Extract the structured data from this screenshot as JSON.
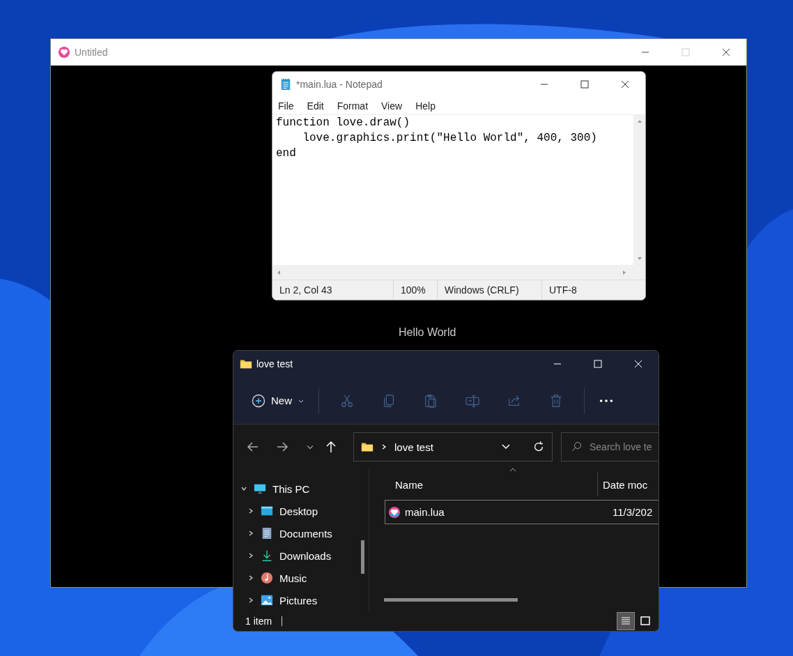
{
  "love_window": {
    "title": "Untitled",
    "canvas_text": "Hello World"
  },
  "notepad": {
    "title": "*main.lua - Notepad",
    "menu": [
      "File",
      "Edit",
      "Format",
      "View",
      "Help"
    ],
    "lines": [
      "function love.draw()",
      "    love.graphics.print(\"Hello World\", 400, 300)",
      "end"
    ],
    "status_bar": [
      "Ln 2, Col 43",
      "100%",
      "Windows (CRLF)",
      "UTF-8"
    ]
  },
  "explorer": {
    "title": "love test",
    "new_button": "New",
    "toolbar": [
      {
        "kind": "cut",
        "disabled": true
      },
      {
        "kind": "copy",
        "disabled": true
      },
      {
        "kind": "paste",
        "disabled": true
      },
      {
        "kind": "rename",
        "disabled": true
      },
      {
        "kind": "share",
        "disabled": true
      },
      {
        "kind": "delete",
        "disabled": true
      }
    ],
    "address": "love test",
    "search": {
      "placeholder": "Search love te"
    },
    "sidebar": [
      {
        "label": "This PC",
        "kind": "pc",
        "expanded": true,
        "children": [
          {
            "label": "Desktop",
            "kind": "desktop",
            "expanded": false
          },
          {
            "label": "Documents",
            "kind": "documents",
            "expanded": false
          },
          {
            "label": "Downloads",
            "kind": "downloads",
            "expanded": false
          },
          {
            "label": "Music",
            "kind": "music",
            "expanded": false
          },
          {
            "label": "Pictures",
            "kind": "pictures",
            "expanded": false
          }
        ]
      }
    ],
    "columns": [
      "Name",
      "Date moc"
    ],
    "rows": [
      {
        "name": "main.lua",
        "date": "11/3/202",
        "selected": true
      }
    ],
    "status_bar": "1 item",
    "views": [
      {
        "kind": "details",
        "selected": true
      },
      {
        "kind": "tiles",
        "selected": false
      }
    ]
  }
}
